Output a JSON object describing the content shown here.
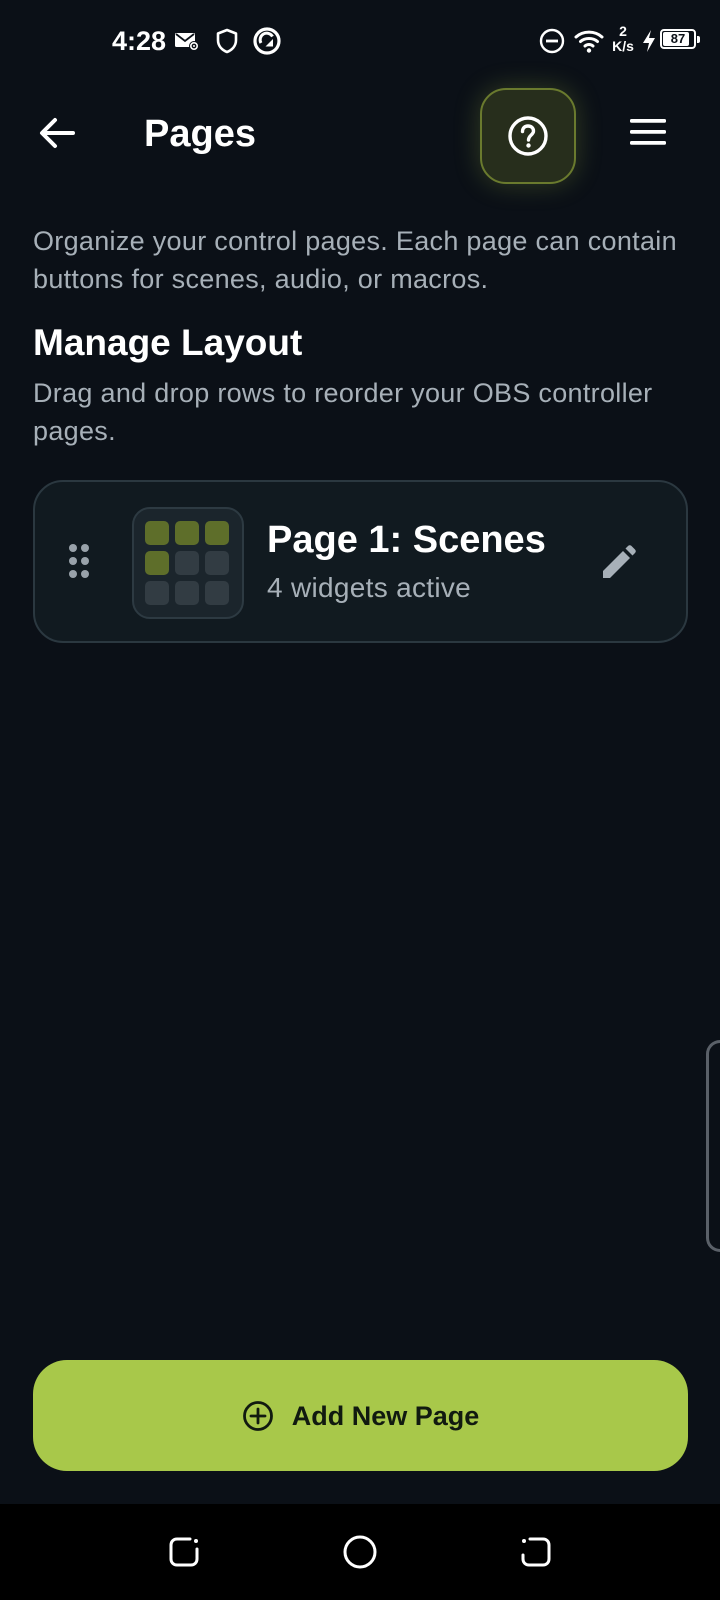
{
  "status_bar": {
    "time": "4:28",
    "icons": [
      "mail-settings-icon",
      "shield-icon",
      "sync-circle-icon",
      "dnd-icon",
      "wifi-icon",
      "charging-bolt-icon"
    ],
    "net_speed_value": "2",
    "net_speed_unit": "K/s",
    "battery_level": "87",
    "battery_fraction": 0.87
  },
  "app_bar": {
    "title": "Pages",
    "back_icon": "arrow-left-icon",
    "help_icon": "help-circle-icon",
    "menu_icon": "hamburger-menu-icon"
  },
  "intro": {
    "text": "Organize your control pages. Each page can contain buttons for scenes, audio, or macros."
  },
  "section": {
    "heading": "Manage Layout",
    "description": "Drag and drop rows to reorder your OBS controller pages."
  },
  "pages": [
    {
      "title": "Page 1: Scenes",
      "subtitle": "4 widgets active",
      "grid": [
        1,
        1,
        1,
        1,
        0,
        0,
        0,
        0,
        0
      ],
      "drag_icon": "drag-handle-icon",
      "edit_icon": "pencil-icon"
    }
  ],
  "add_button": {
    "label": "Add New Page",
    "icon": "plus-circle-icon"
  },
  "nav_bar": {
    "icons": [
      "recents-icon",
      "home-icon",
      "back-icon"
    ]
  },
  "colors": {
    "background": "#0b1017",
    "accent": "#a8c84a",
    "active_cell": "#5e6e2a",
    "inactive_cell": "#323c43",
    "text_secondary": "#a7b0b8"
  }
}
